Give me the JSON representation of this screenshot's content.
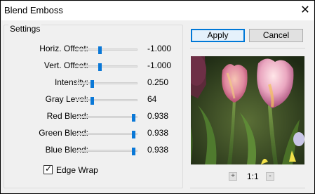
{
  "window": {
    "title": "Blend Emboss"
  },
  "settings": {
    "group_label": "Settings",
    "sliders": [
      {
        "label": "Horiz. Offset:",
        "value": "-1.000",
        "level": 0.38
      },
      {
        "label": "Vert. Offset:",
        "value": "-1.000",
        "level": 0.38
      },
      {
        "label": "Intensity:",
        "value": "0.250",
        "level": 0.25
      },
      {
        "label": "Gray Level:",
        "value": "64",
        "level": 0.25
      },
      {
        "label": "Red Blend:",
        "value": "0.938",
        "level": 0.938
      },
      {
        "label": "Green Blend:",
        "value": "0.938",
        "level": 0.938
      },
      {
        "label": "Blue Blend:",
        "value": "0.938",
        "level": 0.938
      }
    ],
    "edge_wrap": {
      "label": "Edge Wrap",
      "checked": true
    }
  },
  "buttons": {
    "apply": "Apply",
    "cancel": "Cancel"
  },
  "preview": {
    "zoom_label": "1:1",
    "zoom_in": "+",
    "zoom_out": "-"
  },
  "colors": {
    "slider_thumb": "#0a78d7",
    "accent": "#0078d7"
  }
}
